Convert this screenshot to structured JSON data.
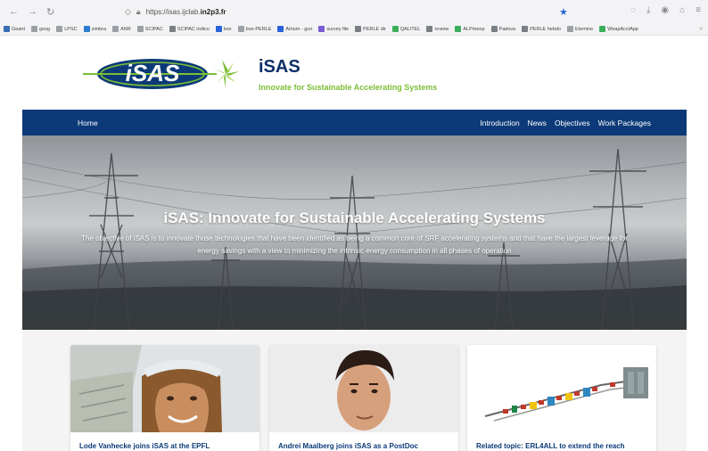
{
  "browser": {
    "url_prefix": "https://isas.ijclab.",
    "url_domain": "in2p3.fr",
    "bookmarks": [
      {
        "label": "Geant",
        "color": "#3d6db5"
      },
      {
        "label": "goog",
        "color": "#9aa0a6"
      },
      {
        "label": "LPSC",
        "color": "#9aa0a6"
      },
      {
        "label": "zimbra",
        "color": "#2a7fd4"
      },
      {
        "label": "ANR",
        "color": "#9aa0a6"
      },
      {
        "label": "SCIPAC",
        "color": "#9aa0a6"
      },
      {
        "label": "SCIPAC indico",
        "color": "#7a7f86"
      },
      {
        "label": "box",
        "color": "#2a62d9"
      },
      {
        "label": "box-PERLE",
        "color": "#9aa0a6"
      },
      {
        "label": "Atrium - gun",
        "color": "#2a62d9"
      },
      {
        "label": "survey file",
        "color": "#7b5bd6"
      },
      {
        "label": "PERLE dir",
        "color": "#7a7f86"
      },
      {
        "label": "QALITEL",
        "color": "#3cae5b"
      },
      {
        "label": "review",
        "color": "#7a7f86"
      },
      {
        "label": "ALPmeop",
        "color": "#3cae5b"
      },
      {
        "label": "Padova",
        "color": "#7a7f86"
      },
      {
        "label": "PERLE hebdo",
        "color": "#7a7f86"
      },
      {
        "label": "Etemine",
        "color": "#9aa0a6"
      },
      {
        "label": "WeapAcctApp",
        "color": "#3cae5b"
      }
    ]
  },
  "site": {
    "logo_text": "iSAS",
    "title": "iSAS",
    "tagline": "Innovate for Sustainable Accelerating Systems",
    "colors": {
      "navy": "#0c3a78",
      "green": "#7cbd36"
    }
  },
  "nav": {
    "home": "Home",
    "items": [
      "Introduction",
      "News",
      "Objectives",
      "Work Packages"
    ]
  },
  "hero": {
    "title": "iSAS: Innovate for Sustainable Accelerating Systems",
    "text": "The objective of iSAS is to innovate those technologies that have been identified as being a common core of SRF accelerating systems and that have the largest leverage for energy savings with a view to minimizing the intrinsic energy consumption in all phases of operation"
  },
  "cards": [
    {
      "title": "Lode Vanhecke joins iSAS at the EPFL"
    },
    {
      "title": "Andrei Maalberg joins iSAS as a PostDoc"
    },
    {
      "title": "Related topic: ERL4ALL to extend the reach"
    }
  ]
}
